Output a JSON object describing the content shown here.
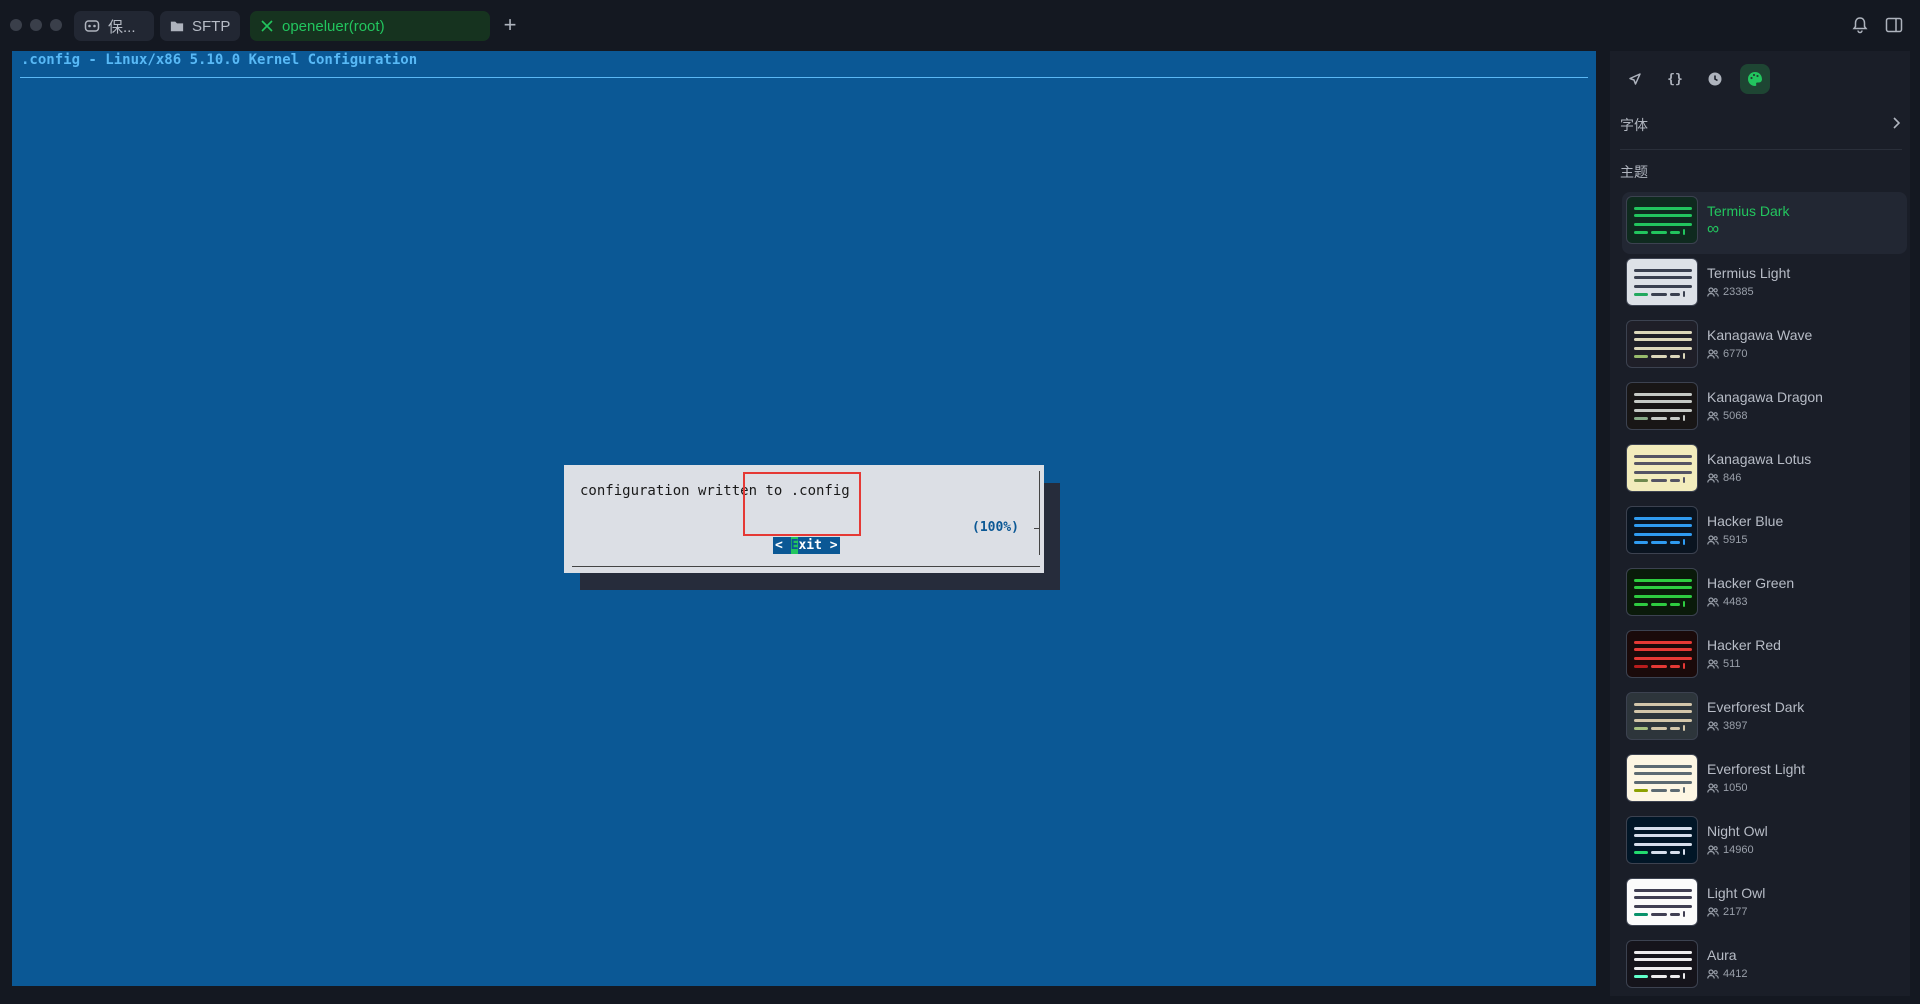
{
  "tabs": [
    {
      "label": "保...",
      "icon": "ai-bot-icon",
      "active": false
    },
    {
      "label": "SFTP",
      "icon": "folder-icon",
      "active": false
    },
    {
      "label": "openeluer(root)",
      "icon": "close-icon",
      "active": true
    }
  ],
  "terminal": {
    "title": ".config - Linux/x86 5.10.0 Kernel Configuration",
    "dialog": {
      "message": "configuration written to .config",
      "percent": "(100%)",
      "exit": {
        "left": "< ",
        "hotkey": "E",
        "rest": "xit",
        "right": " >"
      }
    },
    "colors": {
      "background": "#0b5895",
      "dialog": "#dcdfe5",
      "highlight": "#22c55e"
    }
  },
  "panel": {
    "icons": [
      "rocket-icon",
      "braces-icon",
      "history-icon",
      "palette-icon"
    ],
    "font_label": "字体",
    "themes_title": "主题",
    "accent": "#22c55e",
    "themes": [
      {
        "name": "Termius Dark",
        "users": "∞",
        "active": true,
        "bg": "#0f2a1f",
        "line": "#22c55e",
        "accent": "#22c55e"
      },
      {
        "name": "Termius Light",
        "users": "23385",
        "active": false,
        "bg": "#dde1e7",
        "line": "#3a4050",
        "accent": "#22a85e"
      },
      {
        "name": "Kanagawa Wave",
        "users": "6770",
        "active": false,
        "bg": "#1f1f28",
        "line": "#dcd7ba",
        "accent": "#98bb6c"
      },
      {
        "name": "Kanagawa Dragon",
        "users": "5068",
        "active": false,
        "bg": "#181616",
        "line": "#c5c9c5",
        "accent": "#87a987"
      },
      {
        "name": "Kanagawa Lotus",
        "users": "846",
        "active": false,
        "bg": "#f2ecbc",
        "line": "#545464",
        "accent": "#6f894e"
      },
      {
        "name": "Hacker Blue",
        "users": "5915",
        "active": false,
        "bg": "#0a1420",
        "line": "#2f9bf0",
        "accent": "#2f9bf0"
      },
      {
        "name": "Hacker Green",
        "users": "4483",
        "active": false,
        "bg": "#0a1a0a",
        "line": "#2ecc40",
        "accent": "#2ecc40"
      },
      {
        "name": "Hacker Red",
        "users": "511",
        "active": false,
        "bg": "#1a0a0a",
        "line": "#e53935",
        "accent": "#b71c1c"
      },
      {
        "name": "Everforest Dark",
        "users": "3897",
        "active": false,
        "bg": "#2d353b",
        "line": "#d3c6aa",
        "accent": "#a7c080"
      },
      {
        "name": "Everforest Light",
        "users": "1050",
        "active": false,
        "bg": "#fdf6e3",
        "line": "#5c6a72",
        "accent": "#8da101"
      },
      {
        "name": "Night Owl",
        "users": "14960",
        "active": false,
        "bg": "#011627",
        "line": "#d6deeb",
        "accent": "#22da6e"
      },
      {
        "name": "Light Owl",
        "users": "2177",
        "active": false,
        "bg": "#fbfbfb",
        "line": "#403f53",
        "accent": "#08916a"
      },
      {
        "name": "Aura",
        "users": "4412",
        "active": false,
        "bg": "#15141b",
        "line": "#edecee",
        "accent": "#61ffca"
      }
    ]
  }
}
